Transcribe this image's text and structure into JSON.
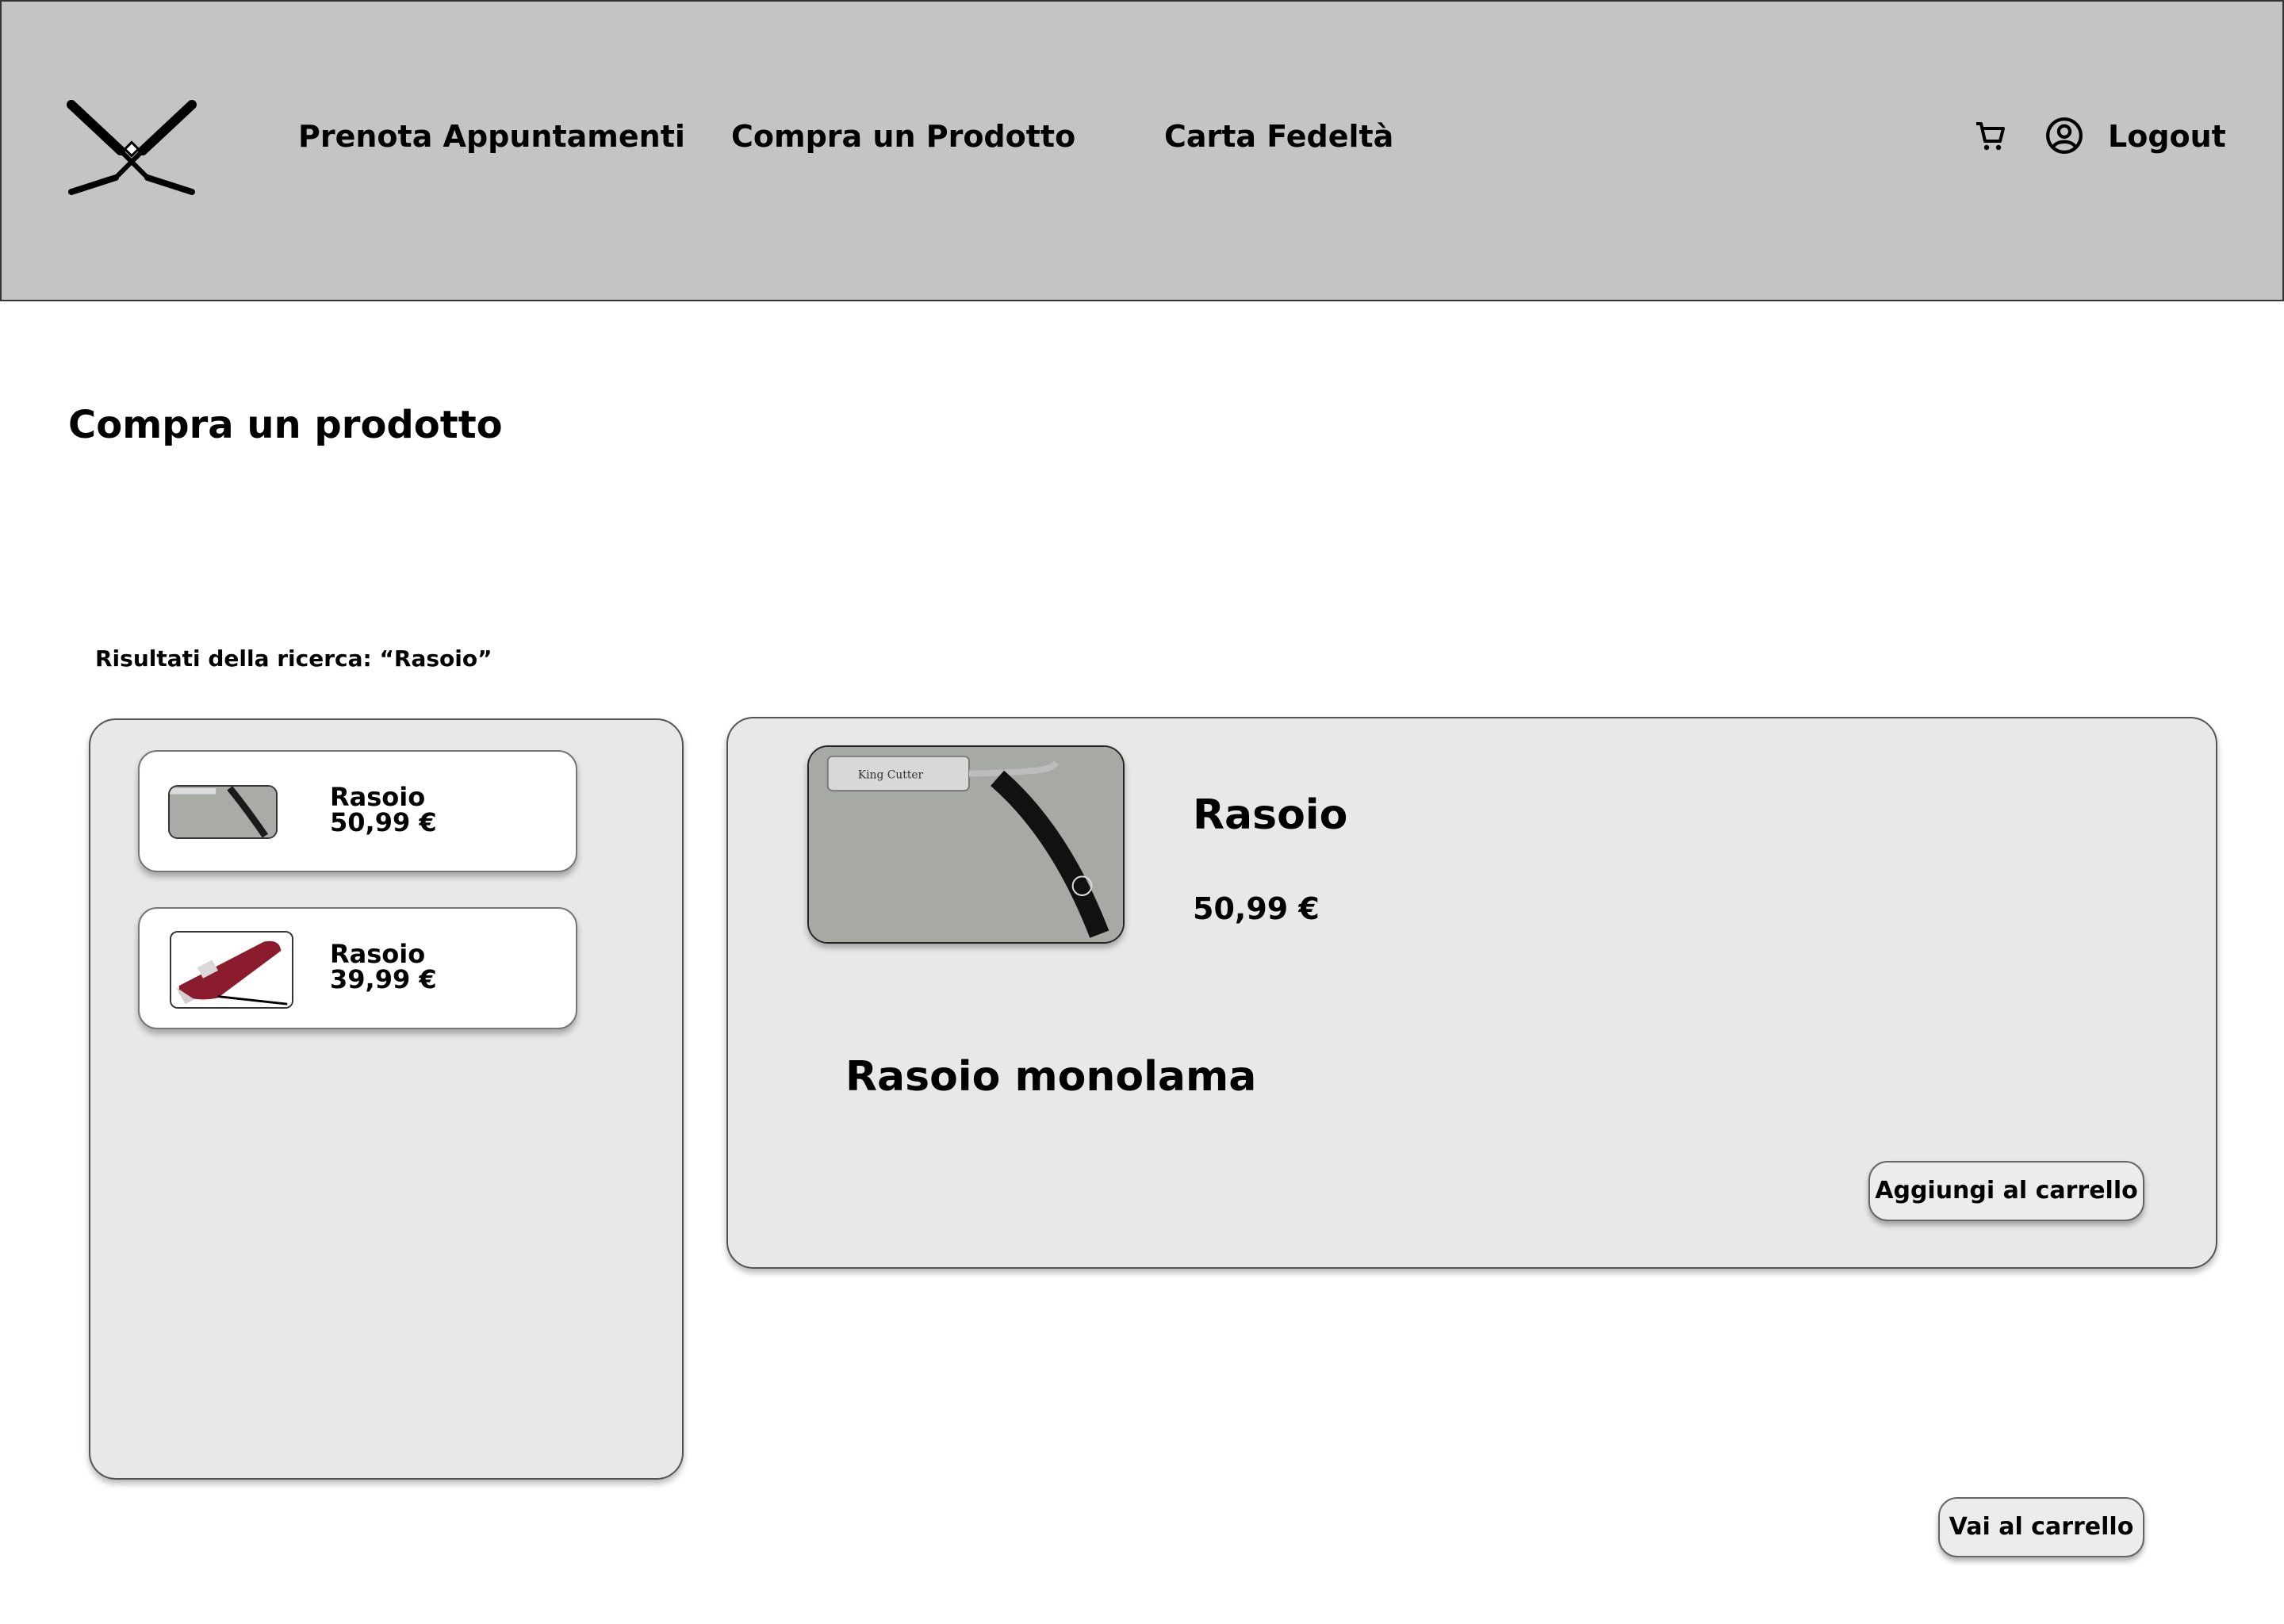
{
  "header": {
    "nav": {
      "appointments": "Prenota Appuntamenti",
      "buy_product": "Compra un Prodotto",
      "loyalty_card": "Carta Fedeltà"
    },
    "logout_label": "Logout",
    "icons": {
      "logo": "crossed-razors-icon",
      "cart": "cart-icon",
      "user": "user-circle-icon"
    }
  },
  "main": {
    "title": "Compra un prodotto",
    "search_label": "Risultati della ricerca: “Rasoio”",
    "results": [
      {
        "name": "Rasoio",
        "price": "50,99 €",
        "image": "straight-razor-image"
      },
      {
        "name": "Rasoio",
        "price": "39,99 €",
        "image": "hair-clipper-image"
      }
    ],
    "detail": {
      "name": "Rasoio",
      "price": "50,99 €",
      "description": "Rasoio monolama",
      "add_to_cart_label": "Aggiungi al carrello",
      "image": "straight-razor-image"
    },
    "go_to_cart_label": "Vai al carrello"
  },
  "colors": {
    "header_bg": "#c4c4c4",
    "panel_bg": "#e8e8e8",
    "text": "#000000"
  }
}
